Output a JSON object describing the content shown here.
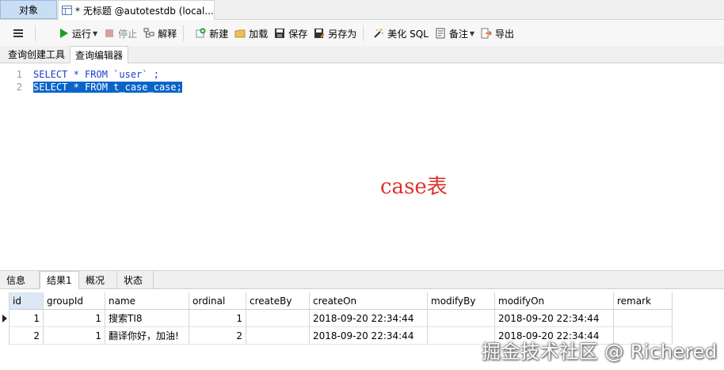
{
  "top_tabs": {
    "objects": "对象",
    "query": "* 无标题 @autotestdb (local..."
  },
  "toolbar": {
    "run": "运行",
    "stop": "停止",
    "explain": "解释",
    "new": "新建",
    "load": "加载",
    "save": "保存",
    "save_as": "另存为",
    "beautify": "美化 SQL",
    "note": "备注",
    "export": "导出"
  },
  "sub_tabs": [
    "查询创建工具",
    "查询编辑器"
  ],
  "editor": {
    "lines": [
      {
        "number": "1",
        "text": "SELECT * FROM `user` ;"
      },
      {
        "number": "2",
        "text": "SELECT * FROM t_case_case;"
      }
    ],
    "annotation": "case表",
    "colors": {
      "keyword": "#1a3fc8",
      "selection": "#0a64c8",
      "annotation": "#e0302a"
    }
  },
  "result_tabs": [
    "信息",
    "结果1",
    "概况",
    "状态"
  ],
  "grid": {
    "columns": [
      "id",
      "groupId",
      "name",
      "ordinal",
      "createBy",
      "createOn",
      "modifyBy",
      "modifyOn",
      "remark"
    ],
    "rows": [
      [
        "1",
        "1",
        "搜索TI8",
        "1",
        "",
        "2018-09-20 22:34:44",
        "",
        "2018-09-20 22:34:44",
        ""
      ],
      [
        "2",
        "1",
        "翻译你好，加油!",
        "2",
        "",
        "2018-09-20 22:34:44",
        "",
        "2018-09-20 22:34:44",
        ""
      ]
    ]
  },
  "watermark": "掘金技术社区 @ Richered"
}
